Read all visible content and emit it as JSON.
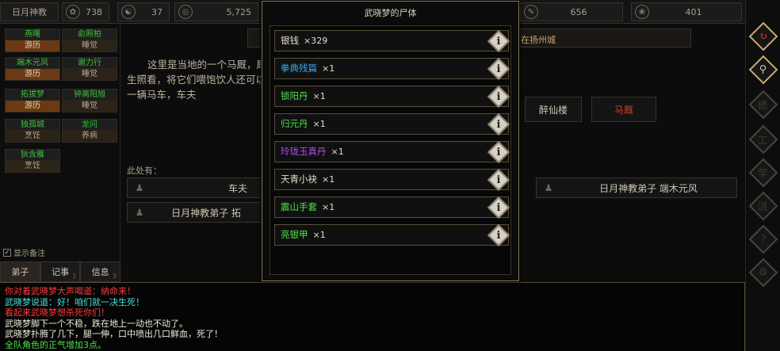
{
  "topbar": {
    "location_label": "日月神教",
    "stats": [
      {
        "icon": "coin-icon",
        "glyph": "✿",
        "value": "738"
      },
      {
        "icon": "yinyang-icon",
        "glyph": "☯",
        "value": "37"
      },
      {
        "icon": "seal-icon",
        "glyph": "◎",
        "value": "5,725"
      },
      {
        "icon": "brush-icon",
        "glyph": "✎",
        "value": "656"
      },
      {
        "icon": "dragon-icon",
        "glyph": "❀",
        "value": "401"
      }
    ]
  },
  "left_panel": {
    "members": [
      {
        "name": "燕曙",
        "status": "游历"
      },
      {
        "name": "俞照柏",
        "status": "睡觉"
      },
      {
        "name": "端木元风",
        "status": "游历"
      },
      {
        "name": "谢力行",
        "status": "睡觉"
      },
      {
        "name": "拓拔梦",
        "status": "游历"
      },
      {
        "name": "钟离阳旭",
        "status": "睡觉"
      },
      {
        "name": "独孤城",
        "status": "烹饪"
      },
      {
        "name": "龙问",
        "status": "养病"
      },
      {
        "name": "狄含雁",
        "status": "烹饪"
      }
    ],
    "show_remark": "显示备注",
    "tabs": [
      {
        "label": "弟子",
        "badge": ""
      },
      {
        "label": "记事",
        "badge": "1"
      },
      {
        "label": "信息",
        "badge": "3"
      }
    ]
  },
  "scene": {
    "location": "在扬州城",
    "description": "这里是当地的一个马厩，厩好生照看，将它们喂饱饮人还可以雇一辆马车，车夫",
    "exits": [
      "醉仙楼",
      "马厩"
    ],
    "here_label": "此处有：",
    "npcs": [
      {
        "name": "车夫"
      },
      {
        "name": "日月神教弟子 端木元风"
      },
      {
        "name": "日月神教弟子 拓"
      }
    ]
  },
  "modal": {
    "title": "武晓梦的尸体",
    "items": [
      {
        "name": "银钱",
        "qty": "×329",
        "color": "#e4dccb"
      },
      {
        "name": "拳典残篇",
        "qty": "×1",
        "color": "#38a8f0"
      },
      {
        "name": "锁阳丹",
        "qty": "×1",
        "color": "#4ee04e"
      },
      {
        "name": "归元丹",
        "qty": "×1",
        "color": "#4ee04e"
      },
      {
        "name": "玲珑玉真丹",
        "qty": "×1",
        "color": "#b04cf0"
      },
      {
        "name": "天青小袂",
        "qty": "×1",
        "color": "#e4dccb"
      },
      {
        "name": "震山手套",
        "qty": "×1",
        "color": "#4ee04e"
      },
      {
        "name": "亮银甲",
        "qty": "×1",
        "color": "#4ee04e"
      }
    ]
  },
  "right_sidebar": [
    {
      "icon": "return-icon",
      "glyph": "↻"
    },
    {
      "icon": "map-pin-icon",
      "glyph": "⚲"
    },
    {
      "icon": "skill-icon",
      "glyph": "修"
    },
    {
      "icon": "craft-icon",
      "glyph": "工"
    },
    {
      "icon": "study-icon",
      "glyph": "学"
    },
    {
      "icon": "sect-icon",
      "glyph": "派"
    },
    {
      "icon": "help-icon",
      "glyph": "?"
    },
    {
      "icon": "settings-icon",
      "glyph": "⚙"
    }
  ],
  "log": [
    {
      "class": "c-red",
      "text": "你对着武晓梦大声喝道：纳命来！"
    },
    {
      "class": "c-cyan",
      "text": "武晓梦说道：好！咱们就一决生死！"
    },
    {
      "class": "c-red",
      "text": "看起来武晓梦想杀死你们！"
    },
    {
      "class": "c-white",
      "text": "武晓梦脚下一个不稳，跌在地上一动也不动了。"
    },
    {
      "class": "c-white",
      "text": "武晓梦扑腾了几下，腿一伸，口中喷出几口鲜血，死了！"
    },
    {
      "class": "c-green",
      "text": "全队角色的正气增加3点。"
    }
  ]
}
